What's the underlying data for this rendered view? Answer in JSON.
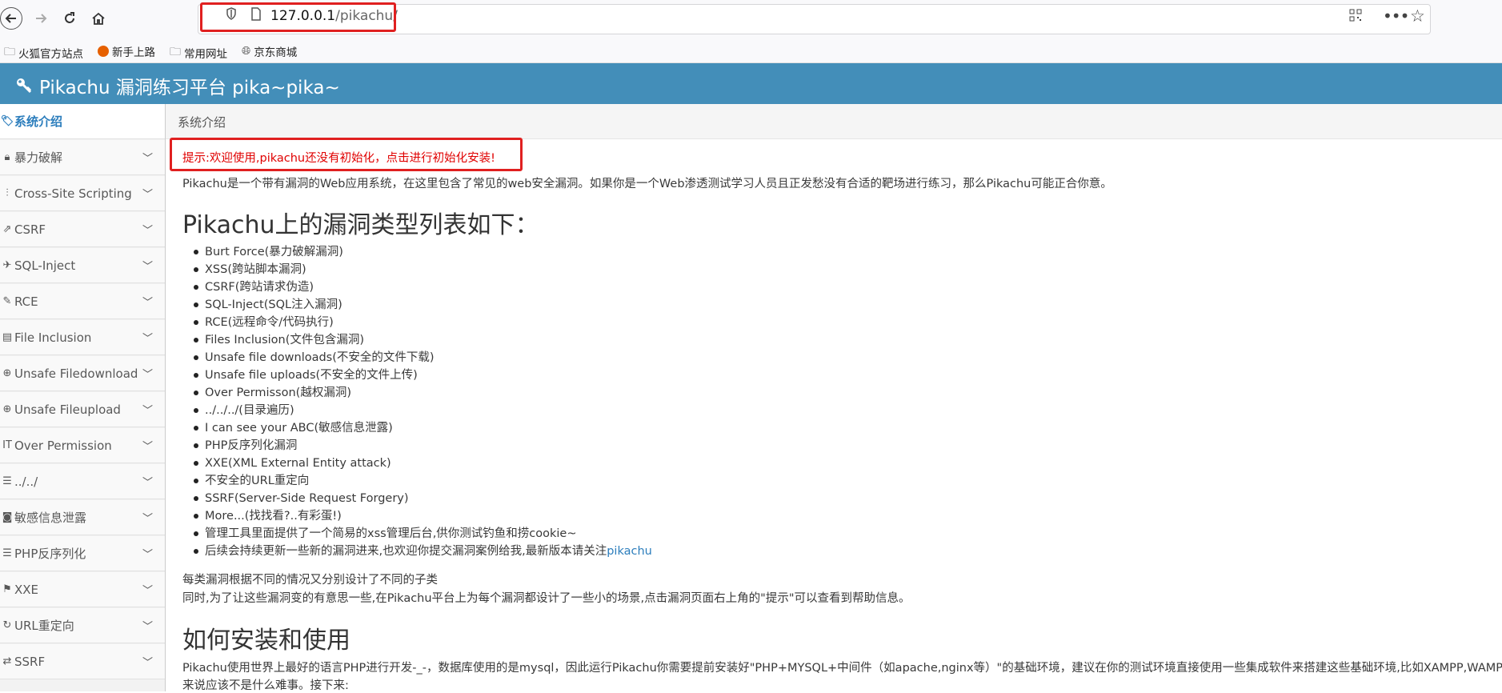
{
  "browser": {
    "url_host": "127.0.0.1",
    "url_path": "/pikachu/",
    "bookmarks": [
      "火狐官方站点",
      "新手上路",
      "常用网址",
      "京东商城"
    ]
  },
  "header": {
    "title": "Pikachu 漏洞练习平台 pika~pika~"
  },
  "sidebar": {
    "items": [
      {
        "label": "系统介绍",
        "icon": "tag-icon"
      },
      {
        "label": "暴力破解",
        "icon": "lock-icon"
      },
      {
        "label": "Cross-Site Scripting",
        "icon": "sliders-icon"
      },
      {
        "label": "CSRF",
        "icon": "share-icon"
      },
      {
        "label": "SQL-Inject",
        "icon": "plane-icon"
      },
      {
        "label": "RCE",
        "icon": "pencil-icon"
      },
      {
        "label": "File Inclusion",
        "icon": "file-icon"
      },
      {
        "label": "Unsafe Filedownload",
        "icon": "download-icon"
      },
      {
        "label": "Unsafe Fileupload",
        "icon": "upload-icon"
      },
      {
        "label": "Over Permission",
        "icon": "text-height-icon"
      },
      {
        "label": "../../",
        "icon": "align-left-icon"
      },
      {
        "label": "敏感信息泄露",
        "icon": "camera-icon"
      },
      {
        "label": "PHP反序列化",
        "icon": "align-left-icon"
      },
      {
        "label": "XXE",
        "icon": "flag-icon"
      },
      {
        "label": "URL重定向",
        "icon": "refresh-icon"
      },
      {
        "label": "SSRF",
        "icon": "exchange-icon"
      }
    ]
  },
  "breadcrumb": {
    "current": "系统介绍"
  },
  "main": {
    "notice": "提示:欢迎使用,pikachu还没有初始化，点击进行初始化安装!",
    "intro": "Pikachu是一个带有漏洞的Web应用系统，在这里包含了常见的web安全漏洞。如果你是一个Web渗透测试学习人员且正发愁没有合适的靶场进行练习，那么Pikachu可能正合你意。",
    "types_heading": "Pikachu上的漏洞类型列表如下：",
    "vuln_types": [
      "Burt Force(暴力破解漏洞)",
      "XSS(跨站脚本漏洞)",
      "CSRF(跨站请求伪造)",
      "SQL-Inject(SQL注入漏洞)",
      "RCE(远程命令/代码执行)",
      "Files Inclusion(文件包含漏洞)",
      "Unsafe file downloads(不安全的文件下载)",
      "Unsafe file uploads(不安全的文件上传)",
      "Over Permisson(越权漏洞)",
      "../../../(目录遍历)",
      "I can see your ABC(敏感信息泄露)",
      "PHP反序列化漏洞",
      "XXE(XML External Entity attack)",
      "不安全的URL重定向",
      "SSRF(Server-Side Request Forgery)",
      "More...(找找看?..有彩蛋!)",
      "管理工具里面提供了一个简易的xss管理后台,供你测试钓鱼和捞cookie~"
    ],
    "last_item_text": "后续会持续更新一些新的漏洞进来,也欢迎你提交漏洞案例给我,最新版本请关注",
    "last_item_link": "pikachu",
    "para1": "每类漏洞根据不同的情况又分别设计了不同的子类",
    "para2": "同时,为了让这些漏洞变的有意思一些,在Pikachu平台上为每个漏洞都设计了一些小的场景,点击漏洞页面右上角的\"提示\"可以查看到帮助信息。",
    "install_heading": "如何安装和使用",
    "install1": "Pikachu使用世界上最好的语言PHP进行开发-_-，数据库使用的是mysql，因此运行Pikachu你需要提前安装好\"PHP+MYSQL+中间件（如apache,nginx等）\"的基础环境，建议在你的测试环境直接使用一些集成软件来搭建这些基础环境,比如XAMPP,WAMP等,",
    "install2": "来说应该不是什么难事。接下来:"
  }
}
